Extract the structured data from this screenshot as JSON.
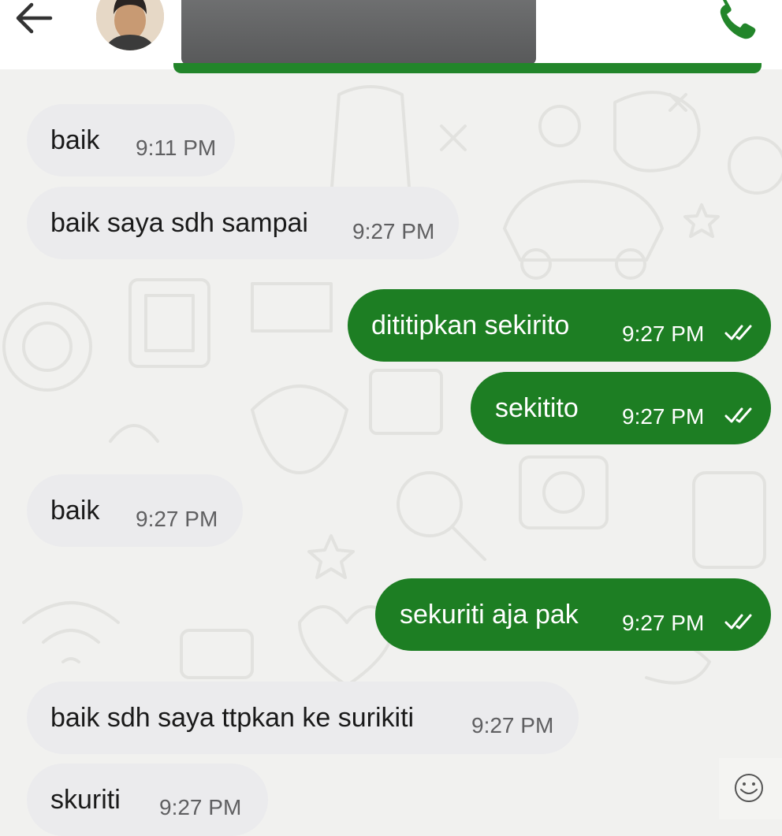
{
  "header": {
    "back_icon": "arrow-left-icon",
    "contact_name": "",
    "call_icon": "phone-icon",
    "accent_color": "#22852a"
  },
  "messages": [
    {
      "direction": "in",
      "text": "baik",
      "time": "9:11 PM"
    },
    {
      "direction": "in",
      "text": "baik saya sdh sampai",
      "time": "9:27 PM"
    },
    {
      "direction": "out",
      "text": "dititipkan sekirito",
      "time": "9:27 PM",
      "status": "read"
    },
    {
      "direction": "out",
      "text": "sekitito",
      "time": "9:27 PM",
      "status": "read"
    },
    {
      "direction": "in",
      "text": "baik",
      "time": "9:27 PM"
    },
    {
      "direction": "out",
      "text": "sekuriti aja pak",
      "time": "9:27 PM",
      "status": "read"
    },
    {
      "direction": "in",
      "text": "baik sdh saya ttpkan ke surikiti",
      "time": "9:27 PM"
    },
    {
      "direction": "in",
      "text": "skuriti",
      "time": "9:27 PM"
    }
  ],
  "colors": {
    "outgoing_bubble": "#1d7e23",
    "incoming_bubble": "#ebebed",
    "chat_background": "#f1f1ef"
  },
  "emoji_icon": "smiley-icon"
}
